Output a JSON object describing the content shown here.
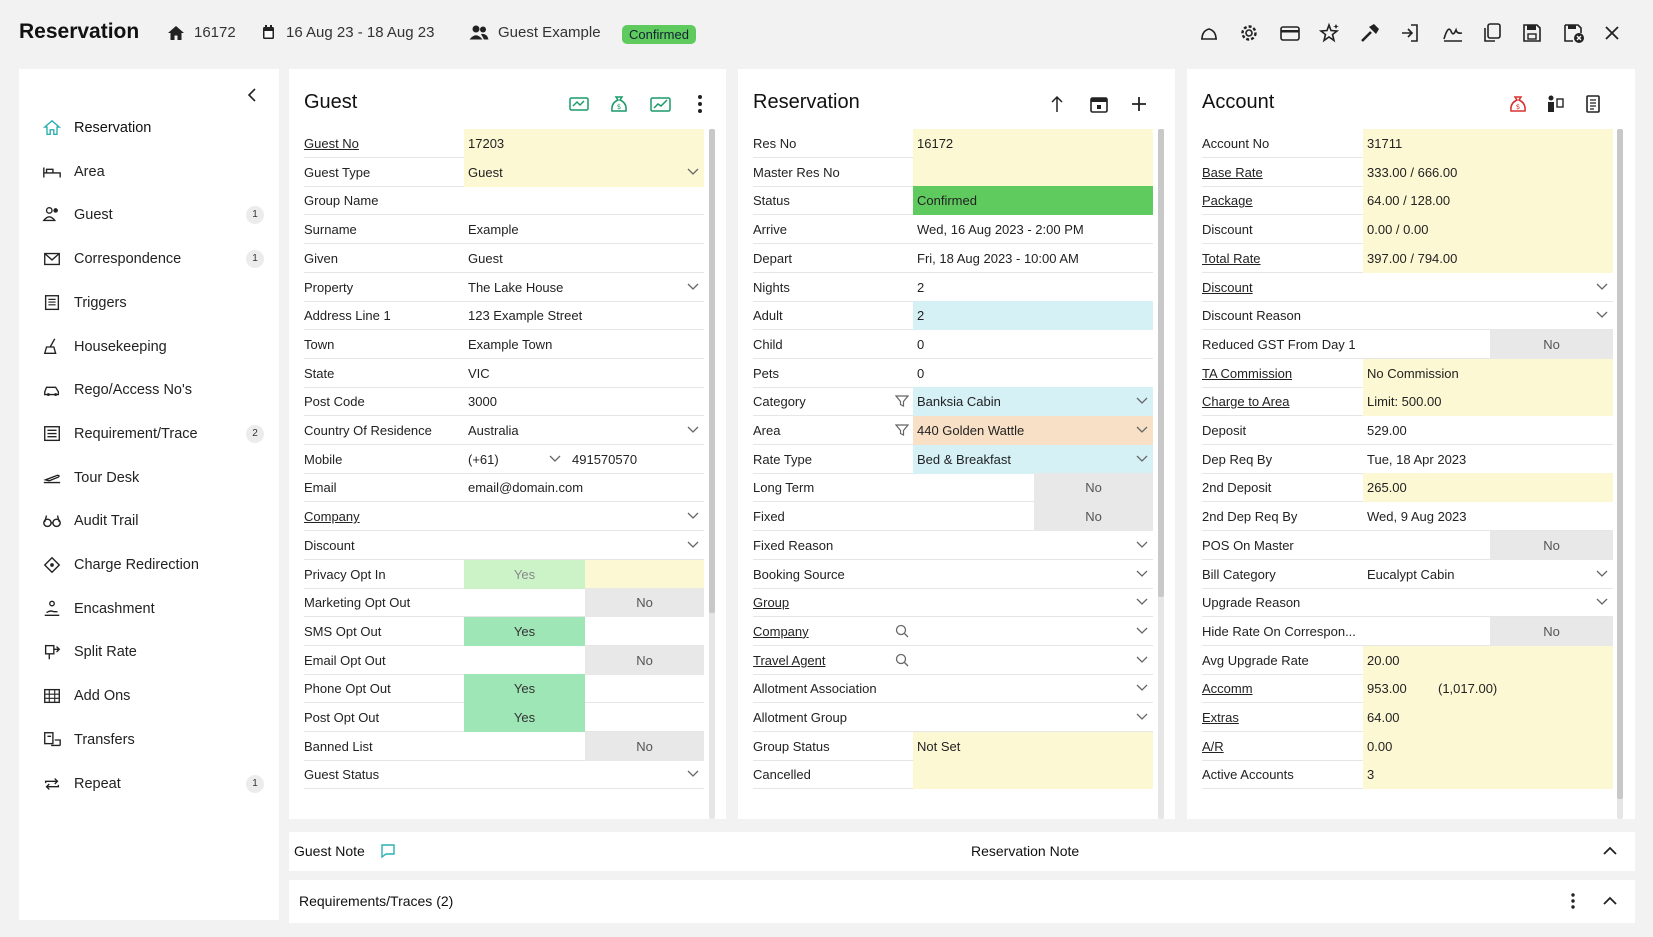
{
  "header": {
    "title": "Reservation",
    "res_no": "16172",
    "dates": "16 Aug 23  -  18 Aug 23",
    "guest": "Guest Example",
    "status": "Confirmed",
    "status_color": "#5fcb5f"
  },
  "toolbar": [
    "bell-icon",
    "gear-icon",
    "card-icon",
    "star-icon",
    "wrench-icon",
    "sign-in-icon",
    "signature-icon",
    "copy-icon",
    "save-icon",
    "save-close-icon",
    "close-icon"
  ],
  "sidebar": {
    "items": [
      {
        "label": "Reservation",
        "icon": "home-icon",
        "count": ""
      },
      {
        "label": "Area",
        "icon": "bed-icon",
        "count": ""
      },
      {
        "label": "Guest",
        "icon": "users-icon",
        "count": "1"
      },
      {
        "label": "Correspondence",
        "icon": "mail-icon",
        "count": "1"
      },
      {
        "label": "Triggers",
        "icon": "list-icon",
        "count": ""
      },
      {
        "label": "Housekeeping",
        "icon": "broom-icon",
        "count": ""
      },
      {
        "label": "Rego/Access No's",
        "icon": "car-icon",
        "count": ""
      },
      {
        "label": "Requirement/Trace",
        "icon": "checklist-icon",
        "count": "2"
      },
      {
        "label": "Tour Desk",
        "icon": "plane-icon",
        "count": ""
      },
      {
        "label": "Audit Trail",
        "icon": "glasses-icon",
        "count": ""
      },
      {
        "label": "Charge Redirection",
        "icon": "diamond-icon",
        "count": ""
      },
      {
        "label": "Encashment",
        "icon": "hand-coin-icon",
        "count": ""
      },
      {
        "label": "Split Rate",
        "icon": "split-icon",
        "count": ""
      },
      {
        "label": "Add Ons",
        "icon": "grid-icon",
        "count": ""
      },
      {
        "label": "Transfers",
        "icon": "bus-icon",
        "count": ""
      },
      {
        "label": "Repeat",
        "icon": "repeat-icon",
        "count": "1"
      }
    ]
  },
  "guest": {
    "title": "Guest",
    "rows": [
      {
        "label": "Guest No",
        "value": "17203",
        "link": true,
        "bg": "y"
      },
      {
        "label": "Guest Type",
        "value": "Guest",
        "bg": "y",
        "dd": true
      },
      {
        "label": "Group Name",
        "value": ""
      },
      {
        "label": "Surname",
        "value": "Example"
      },
      {
        "label": "Given",
        "value": "Guest"
      },
      {
        "label": "Property",
        "value": "The Lake House",
        "dd": true
      },
      {
        "label": "Address Line 1",
        "value": "123 Example Street"
      },
      {
        "label": "Town",
        "value": "Example Town"
      },
      {
        "label": "State",
        "value": "VIC"
      },
      {
        "label": "Post Code",
        "value": "3000"
      },
      {
        "label": "Country Of Residence",
        "value": "Australia",
        "dd": true
      },
      {
        "label": "Mobile",
        "value": "(+61)",
        "extra": "491570570",
        "ddmid": true
      },
      {
        "label": "Email",
        "value": "email@domain.com"
      },
      {
        "label": "Company",
        "value": "",
        "link": true,
        "dd": true
      },
      {
        "label": "Discount",
        "value": "",
        "dd": true
      },
      {
        "label": "Privacy Opt In",
        "toggle": "Yes",
        "style": "yesl"
      },
      {
        "label": "Marketing Opt Out",
        "toggle": "No",
        "style": "no"
      },
      {
        "label": "SMS Opt Out",
        "toggle": "Yes",
        "style": "yes"
      },
      {
        "label": "Email Opt Out",
        "toggle": "No",
        "style": "no"
      },
      {
        "label": "Phone Opt Out",
        "toggle": "Yes",
        "style": "yes"
      },
      {
        "label": "Post Opt Out",
        "toggle": "Yes",
        "style": "yes"
      },
      {
        "label": "Banned List",
        "toggle": "No",
        "style": "no"
      },
      {
        "label": "Guest Status",
        "value": "",
        "dd": true
      }
    ]
  },
  "reservation": {
    "title": "Reservation",
    "rows": [
      {
        "label": "Res No",
        "value": "16172",
        "bg": "y"
      },
      {
        "label": "Master Res No",
        "value": "",
        "bg": "y"
      },
      {
        "label": "Status",
        "value": "Confirmed",
        "bg": "g"
      },
      {
        "label": "Arrive",
        "value": "Wed, 16 Aug 2023 - 2:00 PM"
      },
      {
        "label": "Depart",
        "value": "Fri, 18 Aug 2023 - 10:00 AM"
      },
      {
        "label": "Nights",
        "value": "2"
      },
      {
        "label": "Adult",
        "value": "2",
        "bg": "b"
      },
      {
        "label": "Child",
        "value": "0"
      },
      {
        "label": "Pets",
        "value": "0"
      },
      {
        "label": "Category",
        "value": "Banksia Cabin",
        "bg": "b",
        "dd": true,
        "filter": true
      },
      {
        "label": "Area",
        "value": "440 Golden Wattle",
        "bg": "o",
        "dd": true,
        "filter": true
      },
      {
        "label": "Rate Type",
        "value": "Bed & Breakfast",
        "bg": "b",
        "dd": true
      },
      {
        "label": "Long Term",
        "toggle": "No",
        "style": "no"
      },
      {
        "label": "Fixed",
        "toggle": "No",
        "style": "no"
      },
      {
        "label": "Fixed Reason",
        "value": "",
        "dd": true
      },
      {
        "label": "Booking Source",
        "value": "",
        "dd": true
      },
      {
        "label": "Group",
        "value": "",
        "link": true,
        "dd": true
      },
      {
        "label": "Company",
        "value": "",
        "link": true,
        "dd": true,
        "search": true
      },
      {
        "label": "Travel Agent",
        "value": "",
        "link": true,
        "dd": true,
        "search": true
      },
      {
        "label": "Allotment Association",
        "value": "",
        "dd": true
      },
      {
        "label": "Allotment Group",
        "value": "",
        "dd": true
      },
      {
        "label": "Group Status",
        "value": "Not Set",
        "bg": "y"
      },
      {
        "label": "Cancelled",
        "value": "",
        "bg": "y"
      }
    ]
  },
  "account": {
    "title": "Account",
    "rows": [
      {
        "label": "Account No",
        "value": "31711",
        "bg": "y"
      },
      {
        "label": "Base Rate",
        "value": "333.00 / 666.00",
        "link": true,
        "bg": "y"
      },
      {
        "label": "Package",
        "value": "64.00 / 128.00",
        "link": true,
        "bg": "y"
      },
      {
        "label": "Discount",
        "value": "0.00 / 0.00",
        "bg": "y"
      },
      {
        "label": "Total Rate",
        "value": "397.00 / 794.00",
        "link": true,
        "bg": "y"
      },
      {
        "label": "Discount",
        "value": "",
        "link": true,
        "dd": true
      },
      {
        "label": "Discount Reason",
        "value": "",
        "dd": true
      },
      {
        "label": "Reduced GST From Day 1",
        "toggle": "No",
        "style": "no"
      },
      {
        "label": "TA Commission",
        "value": "No Commission",
        "link": true,
        "bg": "y"
      },
      {
        "label": "Charge to Area",
        "value": "Limit: 500.00",
        "link": true,
        "bg": "y"
      },
      {
        "label": "Deposit",
        "value": "529.00"
      },
      {
        "label": "Dep Req By",
        "value": "Tue, 18 Apr 2023"
      },
      {
        "label": "2nd Deposit",
        "value": "265.00",
        "bg": "y"
      },
      {
        "label": "2nd Dep Req By",
        "value": "Wed, 9 Aug 2023"
      },
      {
        "label": "POS On Master",
        "toggle": "No",
        "style": "no"
      },
      {
        "label": "Bill Category",
        "value": "Eucalypt Cabin",
        "dd": true
      },
      {
        "label": "Upgrade Reason",
        "value": "",
        "dd": true
      },
      {
        "label": "Hide Rate On Correspon...",
        "toggle": "No",
        "style": "no"
      },
      {
        "label": "Avg Upgrade Rate",
        "value": "20.00",
        "bg": "y"
      },
      {
        "label": "Accomm",
        "value": "953.00",
        "extra": "(1,017.00)",
        "link": true,
        "bg": "y"
      },
      {
        "label": "Extras",
        "value": "64.00",
        "link": true,
        "bg": "y"
      },
      {
        "label": "A/R",
        "value": "0.00",
        "link": true,
        "bg": "y"
      },
      {
        "label": "Active Accounts",
        "value": "3",
        "bg": "y"
      }
    ]
  },
  "notes": {
    "guest_note": "Guest Note",
    "reservation_note": "Reservation Note"
  },
  "requirements": {
    "title": "Requirements/Traces (2)"
  }
}
